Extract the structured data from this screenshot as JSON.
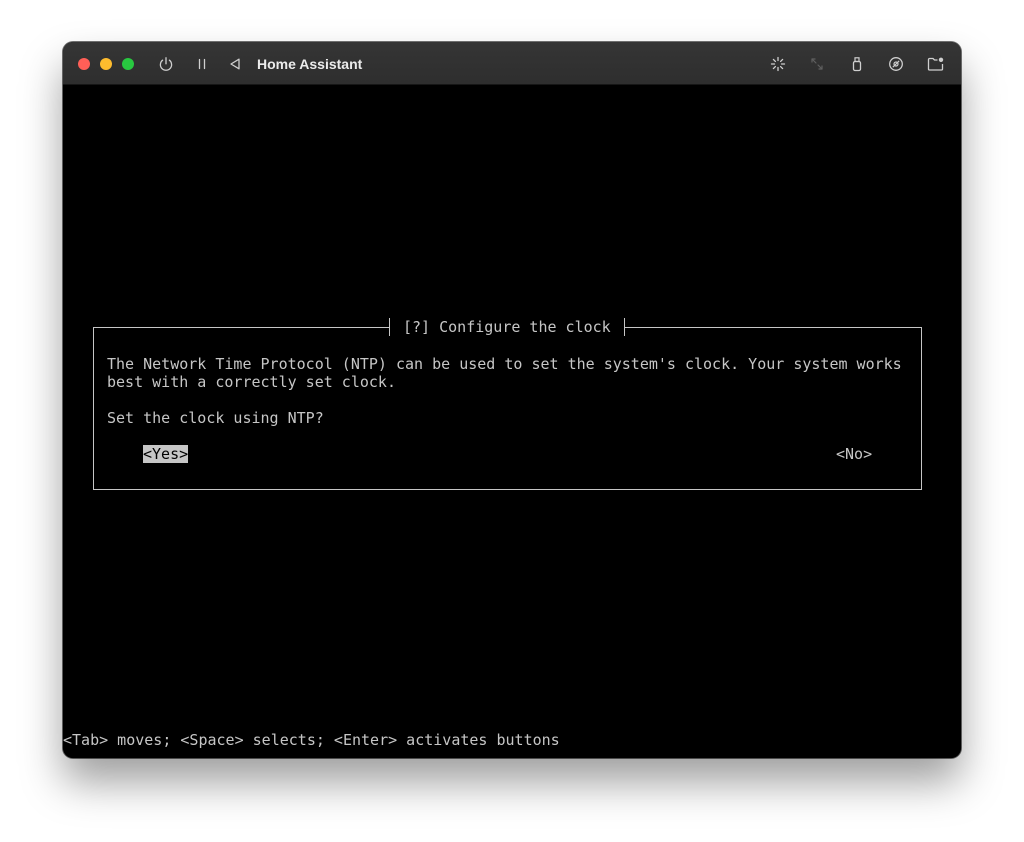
{
  "window": {
    "title": "Home Assistant"
  },
  "toolbar": {
    "left_icons": [
      "power-icon",
      "pause-icon",
      "back-icon"
    ],
    "right_icons": [
      "activity-spinner-icon",
      "resize-icon",
      "usb-device-icon",
      "disc-icon",
      "shared-folder-icon"
    ]
  },
  "dialog": {
    "title": "[?] Configure the clock",
    "message_lines": [
      "The Network Time Protocol (NTP) can be used to set the system's clock. Your system works",
      "best with a correctly set clock."
    ],
    "question": "Set the clock using NTP?",
    "buttons": {
      "yes": "<Yes>",
      "no": "<No>"
    },
    "selected_button": "yes"
  },
  "help_line": "<Tab> moves; <Space> selects; <Enter> activates buttons",
  "colors": {
    "close": "#ff5f57",
    "minimize": "#febc2e",
    "zoom": "#28c840",
    "titlebar": "#2e2e2e",
    "terminal_bg": "#000000",
    "terminal_text": "#c6c6c6",
    "selected_bg": "#c6c6c6",
    "selected_text": "#000000"
  }
}
